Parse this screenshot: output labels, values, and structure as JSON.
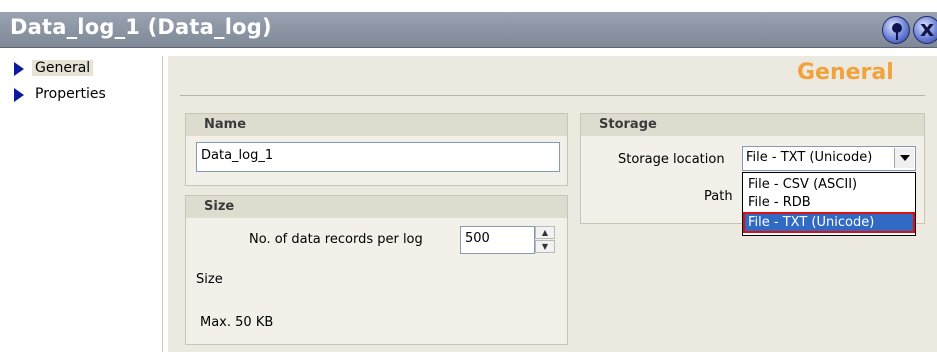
{
  "window": {
    "title": "Data_log_1 (Data_log)",
    "pin_icon": "pin-icon",
    "close_icon": "close-icon"
  },
  "nav": {
    "items": [
      {
        "label": "General",
        "selected": true
      },
      {
        "label": "Properties",
        "selected": false
      }
    ]
  },
  "section": {
    "title": "General",
    "title_color": "#f0a33c"
  },
  "name_group": {
    "header": "Name",
    "value": "Data_log_1"
  },
  "size_group": {
    "header": "Size",
    "records_label": "No. of data records per log",
    "records_value": "500",
    "size_label": "Size",
    "max_text": "Max. 50 KB"
  },
  "storage_group": {
    "header": "Storage",
    "location_label": "Storage location",
    "location_value": "File - TXT (Unicode)",
    "path_label": "Path",
    "options": [
      "File - CSV (ASCII)",
      "File - RDB",
      "File - TXT (Unicode)"
    ],
    "highlight_color": "#316ac5"
  }
}
